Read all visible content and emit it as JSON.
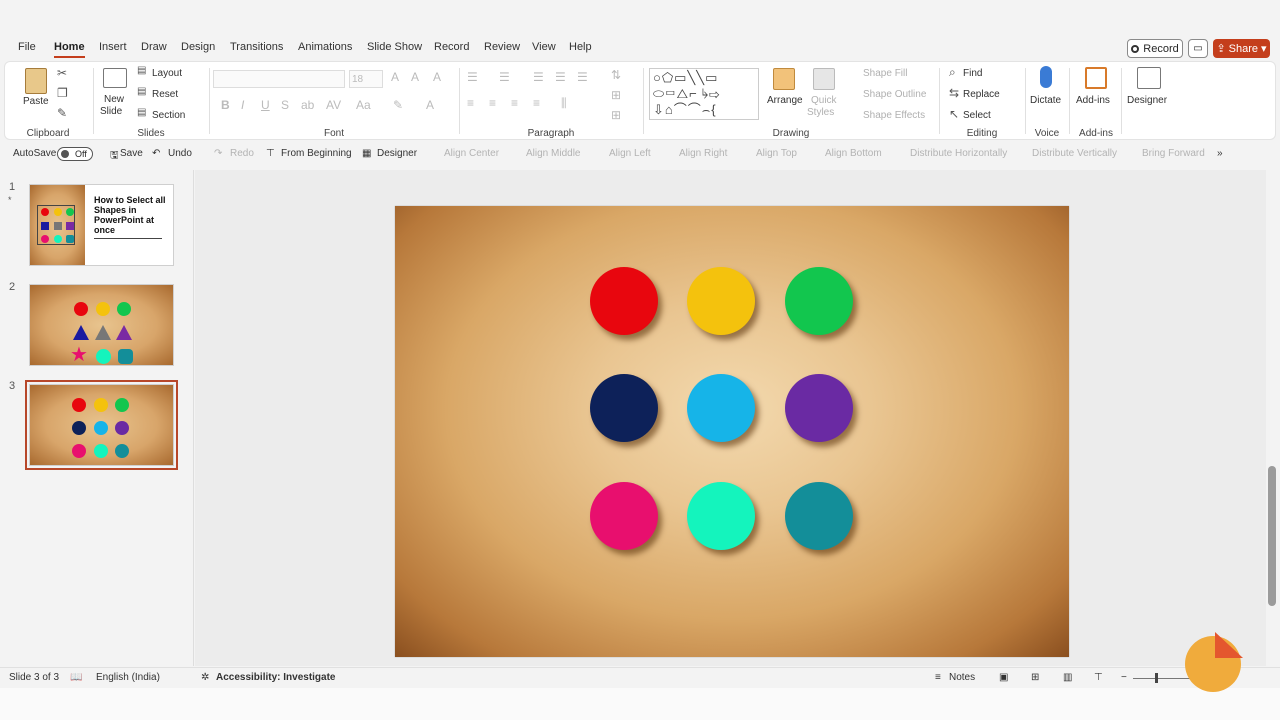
{
  "menu": {
    "tabs": [
      "File",
      "Home",
      "Insert",
      "Draw",
      "Design",
      "Transitions",
      "Animations",
      "Slide Show",
      "Record",
      "Review",
      "View",
      "Help"
    ],
    "active": "Home",
    "record_label": "Record",
    "share_label": "Share"
  },
  "ribbon": {
    "clipboard": {
      "paste": "Paste",
      "label": "Clipboard"
    },
    "slides": {
      "new_slide": "New",
      "new_slide2": "Slide",
      "layout": "Layout",
      "reset": "Reset",
      "section": "Section",
      "label": "Slides"
    },
    "font": {
      "size": "18",
      "label": "Font"
    },
    "paragraph": {
      "label": "Paragraph"
    },
    "drawing": {
      "arrange": "Arrange",
      "quick_styles": "Quick",
      "quick_styles2": "Styles",
      "shape_fill": "Shape Fill",
      "shape_outline": "Shape Outline",
      "shape_effects": "Shape Effects",
      "label": "Drawing"
    },
    "editing": {
      "find": "Find",
      "replace": "Replace",
      "select": "Select",
      "label": "Editing"
    },
    "voice": {
      "dictate": "Dictate",
      "label": "Voice"
    },
    "addins": {
      "addins": "Add-ins",
      "label": "Add-ins"
    },
    "designer": {
      "designer": "Designer"
    }
  },
  "qat": {
    "autosave": "AutoSave",
    "toggle": "Off",
    "save": "Save",
    "undo": "Undo",
    "redo": "Redo",
    "from_beginning": "From Beginning",
    "designer": "Designer",
    "align_center": "Align Center",
    "align_middle": "Align Middle",
    "align_left": "Align Left",
    "align_right": "Align Right",
    "align_top": "Align Top",
    "align_bottom": "Align Bottom",
    "distribute_h": "Distribute Horizontally",
    "distribute_v": "Distribute Vertically",
    "bring_forward": "Bring Forward"
  },
  "thumbnails": [
    {
      "num": "1",
      "title": "How to Select all Shapes in PowerPoint at once"
    },
    {
      "num": "2"
    },
    {
      "num": "3"
    }
  ],
  "slide": {
    "circle_colors": [
      "#e8060e",
      "#f4c20d",
      "#12c64e",
      "#0d2159",
      "#16b4e8",
      "#6a2aa3",
      "#e80f6e",
      "#14f4bd",
      "#138e99"
    ]
  },
  "status": {
    "slide_count": "Slide 3 of 3",
    "language": "English (India)",
    "accessibility": "Accessibility: Investigate",
    "notes": "Notes"
  },
  "colors": {
    "accent": "#c43e1c",
    "selected_outline": "#b7472a"
  }
}
